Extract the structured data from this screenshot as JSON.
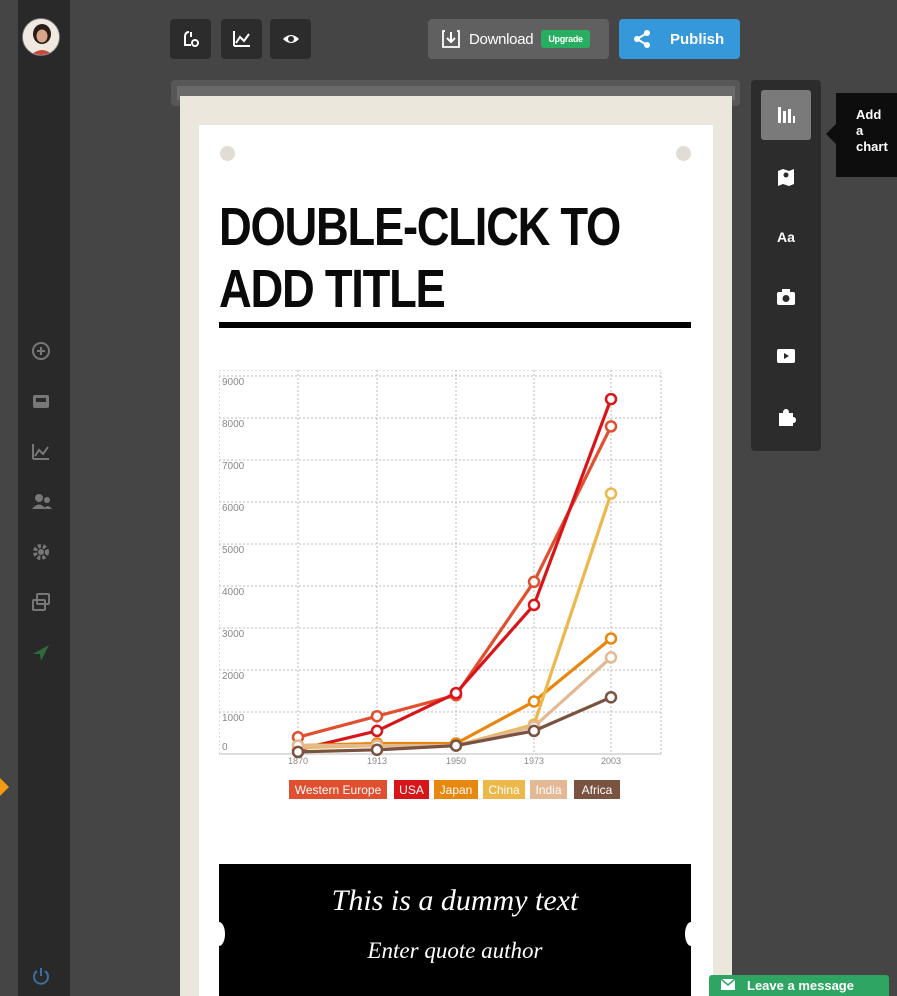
{
  "toolbar": {
    "download_label": "Download",
    "upgrade_label": "Upgrade",
    "publish_label": "Publish"
  },
  "sidebar": {
    "icons": [
      "add-circle-icon",
      "inbox-icon",
      "analytics-icon",
      "users-icon",
      "settings-icon",
      "copy-icon",
      "brand-check-icon",
      "power-icon"
    ]
  },
  "canvas": {
    "title": "DOUBLE-CLICK TO ADD TITLE",
    "quote_text": "This is a dummy text",
    "quote_author": "Enter quote author"
  },
  "right_panel": {
    "items": [
      "chart-icon",
      "map-icon",
      "text-icon",
      "camera-icon",
      "video-icon",
      "puzzle-icon"
    ],
    "text_item_label": "Aa",
    "tooltip": "Add a chart"
  },
  "chat": {
    "leave_message": "Leave a message"
  },
  "colors": {
    "accent_blue": "#3498db",
    "upgrade_green": "#27ae60",
    "chat_green": "#2ea562"
  },
  "chart_data": {
    "type": "line",
    "x": [
      "1870",
      "1913",
      "1950",
      "1973",
      "2003"
    ],
    "ylim": [
      0,
      9000
    ],
    "yticks": [
      "0",
      "1000",
      "2000",
      "3000",
      "4000",
      "5000",
      "6000",
      "7000",
      "8000",
      "9000"
    ],
    "grid": true,
    "legend_position": "bottom",
    "series": [
      {
        "name": "Western Europe",
        "color": "#e04f2f",
        "values": [
          400,
          900,
          1400,
          4100,
          7800
        ]
      },
      {
        "name": "USA",
        "color": "#d8161a",
        "values": [
          100,
          550,
          1450,
          3550,
          8450
        ]
      },
      {
        "name": "Japan",
        "color": "#e8870e",
        "values": [
          200,
          250,
          250,
          1250,
          2750
        ]
      },
      {
        "name": "China",
        "color": "#ecb84a",
        "values": [
          150,
          200,
          200,
          700,
          6200
        ]
      },
      {
        "name": "India",
        "color": "#e3b895",
        "values": [
          200,
          200,
          200,
          650,
          2300
        ]
      },
      {
        "name": "Africa",
        "color": "#7a5240",
        "values": [
          50,
          100,
          200,
          550,
          1350
        ]
      }
    ]
  }
}
